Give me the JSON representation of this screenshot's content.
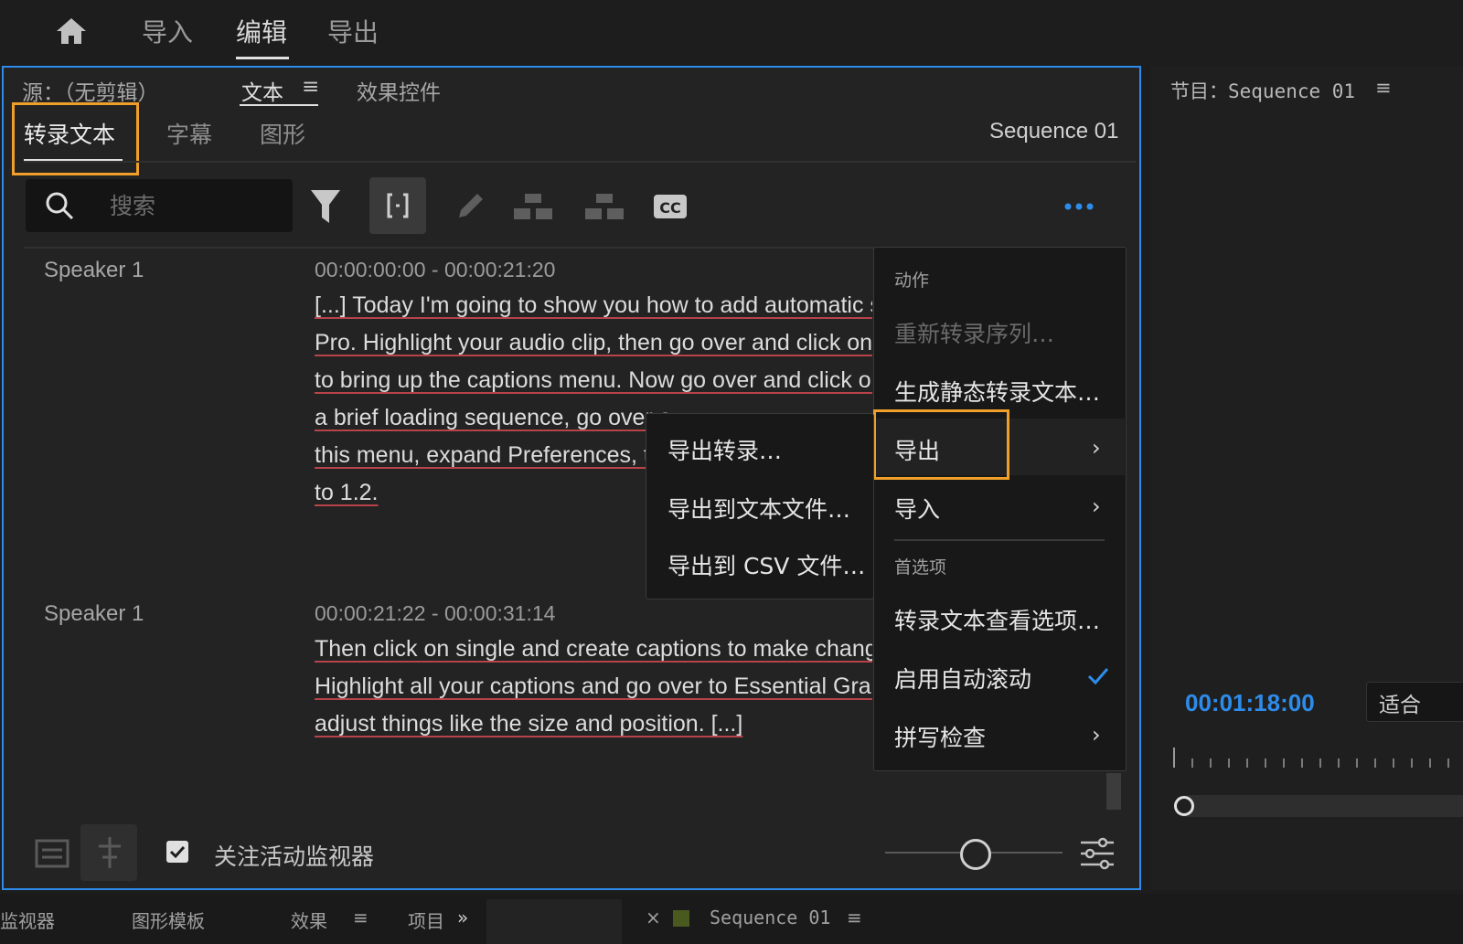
{
  "topnav": {
    "home_icon": "home-icon",
    "items": [
      "导入",
      "编辑",
      "导出"
    ],
    "active": "编辑"
  },
  "source_panel": {
    "tabs": [
      "源：（无剪辑）",
      "文本",
      "效果控件"
    ],
    "menu_icon": "≡",
    "subtabs": [
      "转录文本",
      "字幕",
      "图形"
    ],
    "sequence_name": "Sequence 01",
    "search_placeholder": "搜索",
    "toolbar_icons": [
      "filter-icon",
      "merge-segments-icon",
      "edit-icon",
      "split-icon",
      "merge-icon",
      "cc-icon",
      "more-icon"
    ],
    "transcript": [
      {
        "speaker": "Speaker 1",
        "timecode": "00:00:00:00 - 00:00:21:20",
        "lines": [
          "[...] Today I'm going to show you how to add automatic s",
          "Pro. Highlight your audio clip, then go over and click on w",
          "to bring up the captions menu. Now go over and click on",
          "a brief loading sequence, go over a",
          "this menu, expand Preferences, th",
          "to 1.2."
        ]
      },
      {
        "speaker": "Speaker 1",
        "timecode": "00:00:21:22 - 00:00:31:14",
        "lines": [
          "Then click on single and create captions to make changes",
          "Highlight all your captions and go over to Essential Graph",
          "adjust things like the size and position. [...]"
        ]
      }
    ],
    "footer": {
      "checkbox_label": "关注活动监视器",
      "checked": true
    }
  },
  "context_menu": {
    "section_actions": "动作",
    "items": {
      "retranscribe": "重新转录序列…",
      "static_transcript": "生成静态转录文本…",
      "export": "导出",
      "import": "导入"
    },
    "section_prefs": "首选项",
    "prefs": {
      "view_options": "转录文本查看选项…",
      "autoscroll": "启用自动滚动",
      "spellcheck": "拼写检查"
    }
  },
  "export_submenu": [
    "导出转录…",
    "导出到文本文件…",
    "导出到 CSV 文件…"
  ],
  "program_panel": {
    "title": "节目：Sequence 01",
    "menu_icon": "≡",
    "timecode": "00:01:18:00",
    "fit_label": "适合"
  },
  "bottom_tabs": [
    "监视器",
    "图形模板",
    "效果",
    "≡",
    "项目",
    "»",
    "×",
    "Sequence 01",
    "≡"
  ],
  "colors": {
    "accent_blue": "#2d8ceb",
    "highlight_orange": "#f0a02a",
    "spell_underline": "#b8434b"
  }
}
